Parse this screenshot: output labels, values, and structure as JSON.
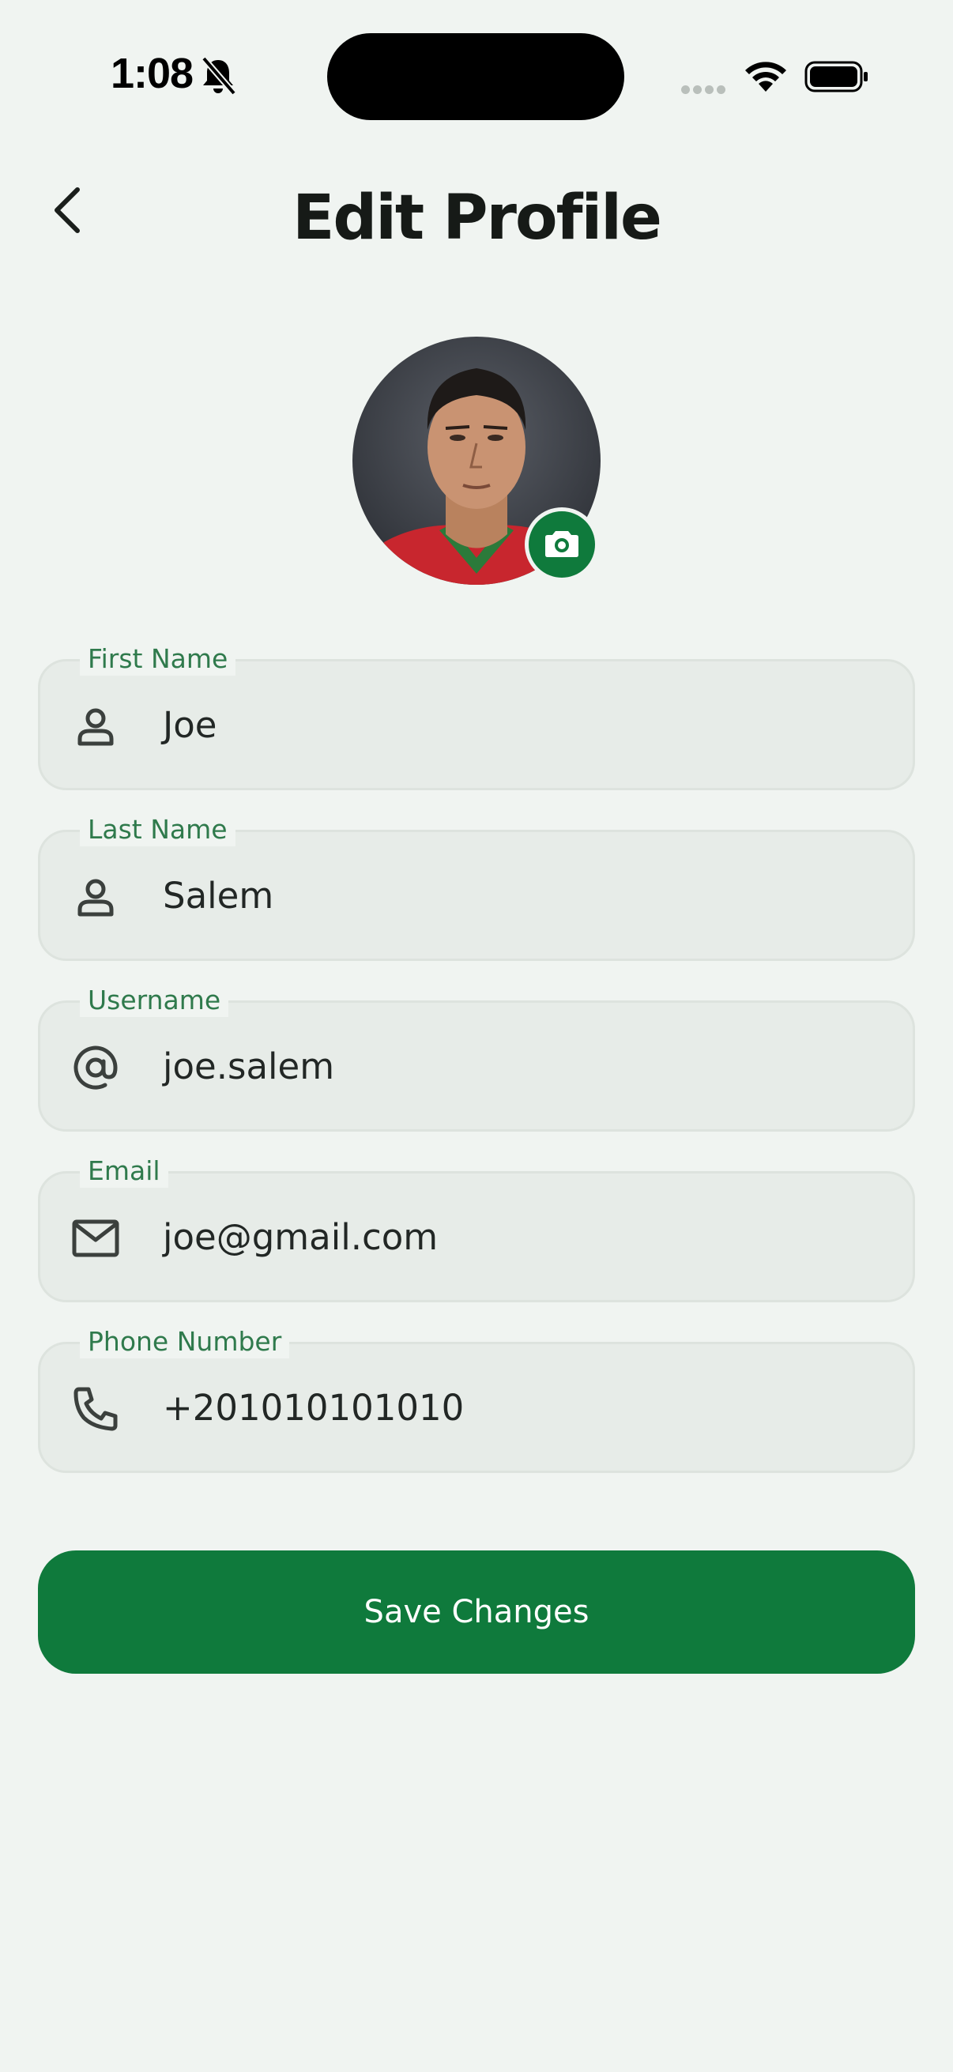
{
  "status_bar": {
    "time": "1:08",
    "icons": [
      "bell-slash-icon",
      "cellular-signal-icon",
      "wifi-icon",
      "battery-icon"
    ]
  },
  "header": {
    "title": "Edit Profile",
    "back_icon": "chevron-left-icon"
  },
  "avatar": {
    "edit_icon": "camera-icon"
  },
  "fields": [
    {
      "label": "First Name",
      "value": "Joe",
      "icon": "person-icon"
    },
    {
      "label": "Last Name",
      "value": "Salem",
      "icon": "person-icon"
    },
    {
      "label": "Username",
      "value": "joe.salem",
      "icon": "at-icon"
    },
    {
      "label": "Email",
      "value": "joe@gmail.com",
      "icon": "mail-icon"
    },
    {
      "label": "Phone Number",
      "value": "+201010101010",
      "icon": "phone-icon"
    }
  ],
  "save_button": {
    "label": "Save Changes"
  },
  "colors": {
    "background": "#f0f4f1",
    "accent": "#0f7a3c",
    "label_green": "#2f7a4c",
    "field_fill": "#e7ece8"
  }
}
